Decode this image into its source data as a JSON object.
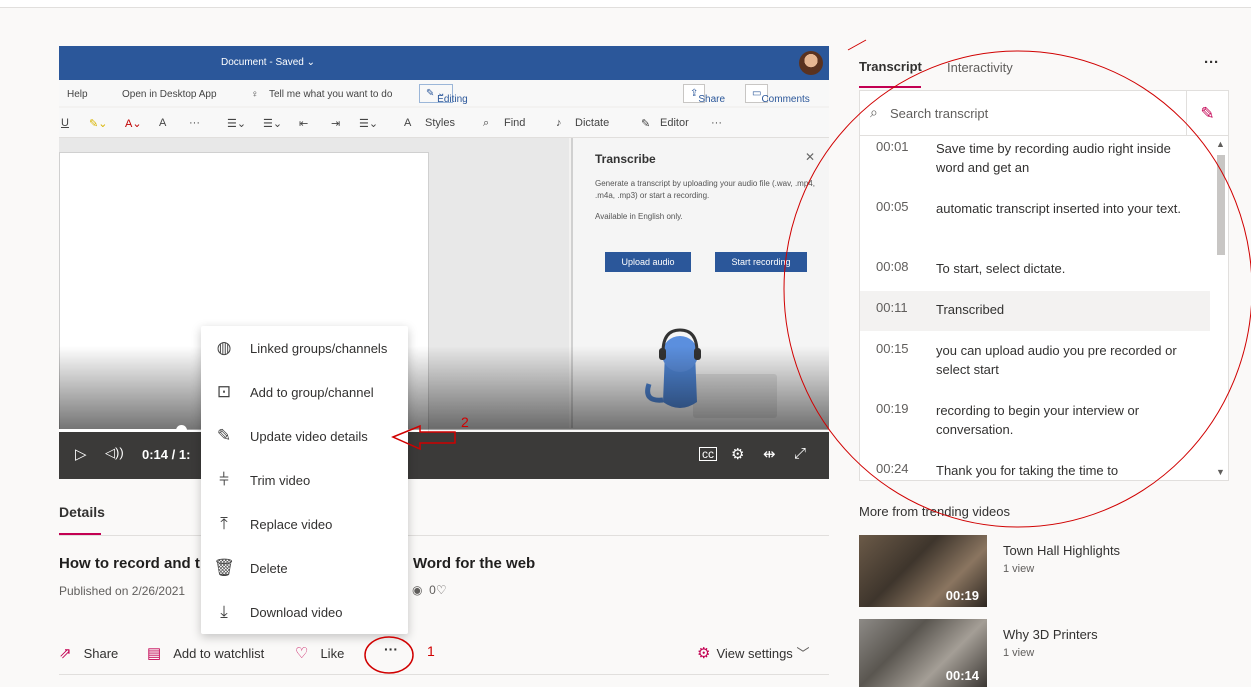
{
  "player": {
    "word": {
      "doc_title": "Document - Saved ⌄",
      "menu_help": "Help",
      "menu_open_desktop": "Open in Desktop App",
      "menu_tell_me": "Tell me what you want to do",
      "editing_label": "Editing",
      "share_label": "Share",
      "comments_label": "Comments",
      "ribbon_styles": "Styles",
      "ribbon_find": "Find",
      "ribbon_dictate": "Dictate",
      "ribbon_editor": "Editor"
    },
    "transcribe_pane": {
      "title": "Transcribe",
      "description": "Generate a transcript by uploading your audio file (.wav, .mp4, .m4a, .mp3) or start a recording.",
      "availability": "Available in English only.",
      "upload_label": "Upload audio",
      "record_label": "Start recording"
    },
    "current_time": "0:14",
    "time_separator": "/ 1:",
    "progress_fraction": 0.158
  },
  "details": {
    "tab_label": "Details",
    "title_start": "How to record and t",
    "title_end": "Word for the web",
    "published": "Published on 2/26/2021",
    "likes_count": "0",
    "actions": {
      "share": "Share",
      "watchlist": "Add to watchlist",
      "like": "Like",
      "more": "···",
      "view_settings": "View settings"
    }
  },
  "context_menu": {
    "items": [
      {
        "label": "Linked groups/channels",
        "icon": "globe-icon"
      },
      {
        "label": "Add to group/channel",
        "icon": "add-to-group-icon"
      },
      {
        "label": "Update video details",
        "icon": "pencil-icon"
      },
      {
        "label": "Trim video",
        "icon": "trim-icon"
      },
      {
        "label": "Replace video",
        "icon": "upload-icon"
      },
      {
        "label": "Delete",
        "icon": "trash-icon"
      },
      {
        "label": "Download video",
        "icon": "download-icon"
      }
    ]
  },
  "right_panel": {
    "tabs": {
      "transcript": "Transcript",
      "interactivity": "Interactivity"
    },
    "more": "···",
    "search_placeholder": "Search transcript",
    "transcript": [
      {
        "time": "00:01",
        "text": "Save time by recording audio right inside word and get an"
      },
      {
        "time": "00:05",
        "text": "automatic transcript inserted into your text."
      },
      {
        "time": "00:08",
        "text": "To start, select dictate."
      },
      {
        "time": "00:11",
        "text": "Transcribed"
      },
      {
        "time": "00:15",
        "text": "you can upload audio you pre recorded or select start"
      },
      {
        "time": "00:19",
        "text": "recording to begin your interview or conversation."
      },
      {
        "time": "00:24",
        "text": "Thank you for taking the time to"
      }
    ],
    "trending_title": "More from trending videos",
    "trending": [
      {
        "title": "Town Hall Highlights",
        "views": "1 view",
        "duration": "00:19"
      },
      {
        "title": "Why 3D Printers",
        "views": "1 view",
        "duration": "00:14"
      }
    ]
  },
  "annotations": {
    "marker_1": "1",
    "marker_2": "2",
    "color": "#d00000"
  },
  "colors": {
    "accent": "#c30052",
    "word_blue": "#2b579a",
    "control_bar": "#3b3a39"
  }
}
